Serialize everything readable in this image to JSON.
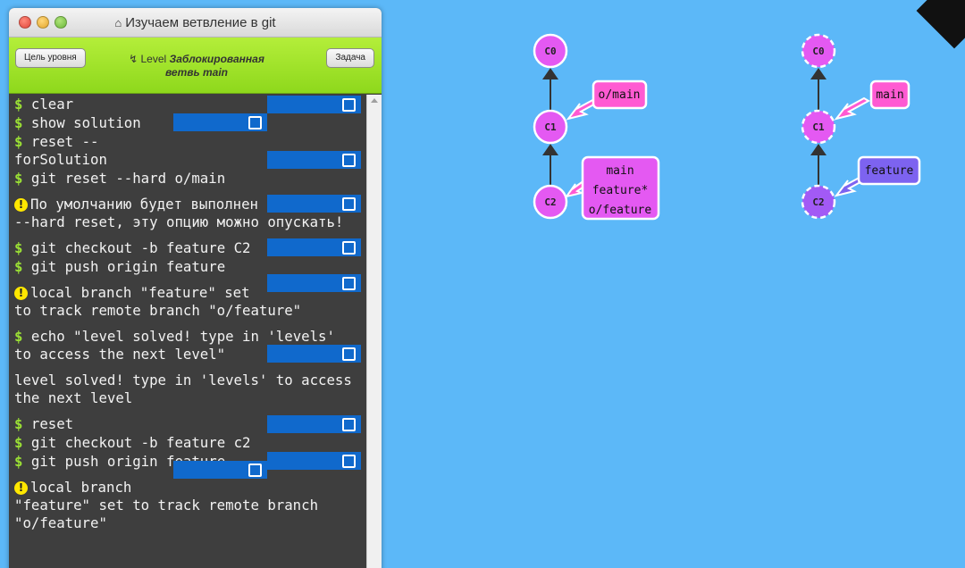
{
  "window": {
    "title": "Изучаем ветвление в git",
    "toolbar": {
      "left_button": "Цель уровня",
      "right_button": "Задача",
      "level_prefix": "Level",
      "level_name_line1": "Заблокированная",
      "level_name_line2": "ветвь main"
    }
  },
  "terminal": {
    "lines": {
      "l1": "clear",
      "l2": "show solution",
      "l3a": "reset --",
      "l3b": "forSolution",
      "l4": "git reset --hard o/main",
      "w1a": "По умолчанию будет выполнен",
      "w1b": "--hard reset, эту опцию можно опускать!",
      "l5": "git checkout -b feature C2",
      "l6": "git push origin feature",
      "w2a": "local branch \"feature\" set",
      "w2b": "to track remote branch \"o/feature\"",
      "l7a": "echo \"level solved! type in 'levels'",
      "l7b": "to access the next level\"",
      "o1a": "level solved! type in 'levels' to access",
      "o1b": "the next level",
      "l8": "reset",
      "l9": "git checkout -b feature c2",
      "l10": "git push origin feature",
      "w3a": "local branch",
      "w3b": "\"feature\" set to track remote branch",
      "w3c": "\"o/feature\""
    }
  },
  "graph_left": {
    "nodes": [
      "C0",
      "C1",
      "C2"
    ],
    "label_c1": "o/main",
    "label_c2": [
      "main",
      "feature*",
      "o/feature"
    ]
  },
  "graph_right": {
    "nodes": [
      "C0",
      "C1",
      "C2"
    ],
    "label_c1": "main",
    "label_c2": "feature"
  },
  "colors": {
    "background": "#5cb8f8",
    "commit": "#e459f2",
    "commit_purple": "#a25af5",
    "branch_pink": "#ff5ad2",
    "branch_purple": "#7d63f0",
    "status_blue": "#1069cc"
  }
}
